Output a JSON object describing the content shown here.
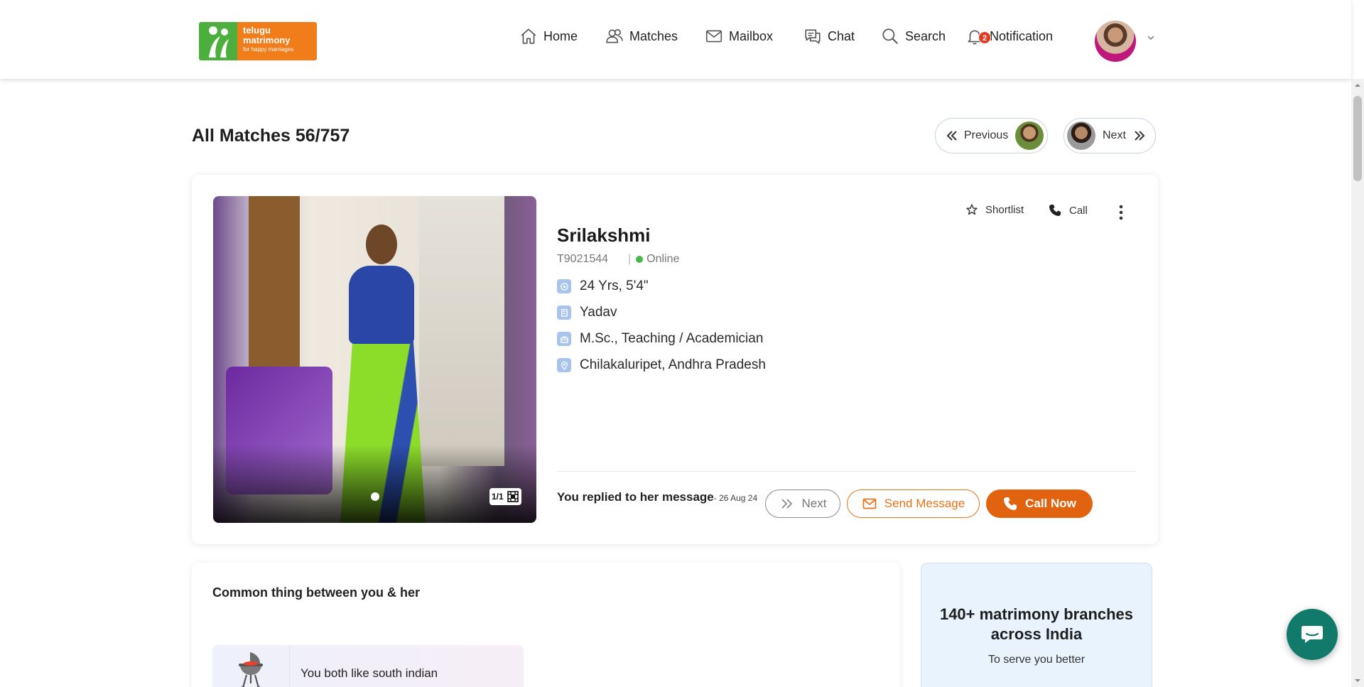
{
  "brand": {
    "line1": "telugu",
    "line2": "matrimony",
    "tagline": "for happy marriages",
    "green": "#4cae3c",
    "orange": "#f07c1a"
  },
  "nav": {
    "items": [
      {
        "label": "Home",
        "icon": "home-icon"
      },
      {
        "label": "Matches",
        "icon": "matches-icon"
      },
      {
        "label": "Mailbox",
        "icon": "mail-icon"
      },
      {
        "label": "Chat",
        "icon": "chat-icon"
      },
      {
        "label": "Search",
        "icon": "search-icon"
      },
      {
        "label": "Notification",
        "icon": "bell-icon"
      }
    ],
    "notification_count": "2"
  },
  "page": {
    "title": "All Matches 56/757",
    "previous_label": "Previous",
    "next_label": "Next"
  },
  "profile": {
    "name": "Srilakshmi",
    "id": "T9021544",
    "status": "Online",
    "age_height": "24 Yrs, 5'4\"",
    "community": "Yadav",
    "education_job": "M.Sc., Teaching / Academician",
    "location": "Chilakaluripet, Andhra Pradesh",
    "photo_count": "1/1",
    "shortlist_label": "Shortlist",
    "call_label": "Call",
    "replied_text": "You replied to her message",
    "replied_date": "- 26 Aug 24",
    "next_button": "Next",
    "send_message_button": "Send Message",
    "call_now_button": "Call Now"
  },
  "common": {
    "title": "Common thing between you & her",
    "item": "You both like south indian"
  },
  "branches": {
    "title": "140+ matrimony branches across India",
    "subtitle": "To serve you better"
  },
  "colors": {
    "accent": "#e2630f",
    "online": "#46b749",
    "badge": "#e03a1f",
    "chat_fab": "#117a6a"
  }
}
